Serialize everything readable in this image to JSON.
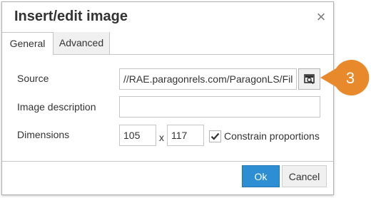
{
  "dialog": {
    "title": "Insert/edit image",
    "close_glyph": "×"
  },
  "tabs": [
    {
      "label": "General",
      "active": true
    },
    {
      "label": "Advanced",
      "active": false
    }
  ],
  "form": {
    "source_label": "Source",
    "source_value": "//RAE.paragonrels.com/ParagonLS/Fil",
    "browse_icon": "image-browse-icon",
    "description_label": "Image description",
    "description_value": "",
    "dimensions_label": "Dimensions",
    "width_value": "105",
    "times_glyph": "x",
    "height_value": "117",
    "constrain_label": "Constrain proportions",
    "constrain_checked": true
  },
  "buttons": {
    "ok_label": "Ok",
    "cancel_label": "Cancel"
  },
  "callout": {
    "number": "3",
    "color": "#e88a2c"
  },
  "colors": {
    "primary_button": "#2e8ed4",
    "border": "#c5c5c5",
    "text": "#333333"
  }
}
